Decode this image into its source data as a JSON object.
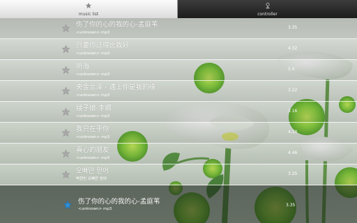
{
  "tabs": [
    {
      "label": "music list",
      "icon": "star-icon",
      "active": true
    },
    {
      "label": "controller",
      "icon": "controller-icon",
      "active": false
    }
  ],
  "songs": [
    {
      "title": "伤了你的心的我的心-孟庭苇",
      "subtitle": "<unknown> mp3",
      "duration": "3.35"
    },
    {
      "title": "只要你过得比我好",
      "subtitle": "<unknown> mp3",
      "duration": "4.32"
    },
    {
      "title": "听海",
      "subtitle": "<unknown> mp3",
      "duration": "5.0"
    },
    {
      "title": "央金兰泽 - 遇上你是我的缘",
      "subtitle": "<unknown> mp3",
      "duration": "3.22"
    },
    {
      "title": "嫂子娘-李娜",
      "subtitle": "<unknown> mp3",
      "duration": "3.16"
    },
    {
      "title": "我只在乎你",
      "subtitle": "<unknown> mp3",
      "duration": "4.10"
    },
    {
      "title": "真心的朋友",
      "subtitle": "<unknown> mp3",
      "duration": "4.46"
    },
    {
      "title": "오빠만 믿어",
      "subtitle": "박현빈 오빠만 믿어",
      "duration": "3.25"
    }
  ],
  "now_playing": {
    "title": "伤了你的心的我的心-孟庭苇",
    "subtitle": "<unknown> mp3",
    "duration": "3.35",
    "icon": "star-icon"
  },
  "colors": {
    "accent_star": "#2e8fd6",
    "row_star": "#a9a9a9",
    "active_tab": "#efefef",
    "inactive_tab": "#2a2a2a"
  }
}
